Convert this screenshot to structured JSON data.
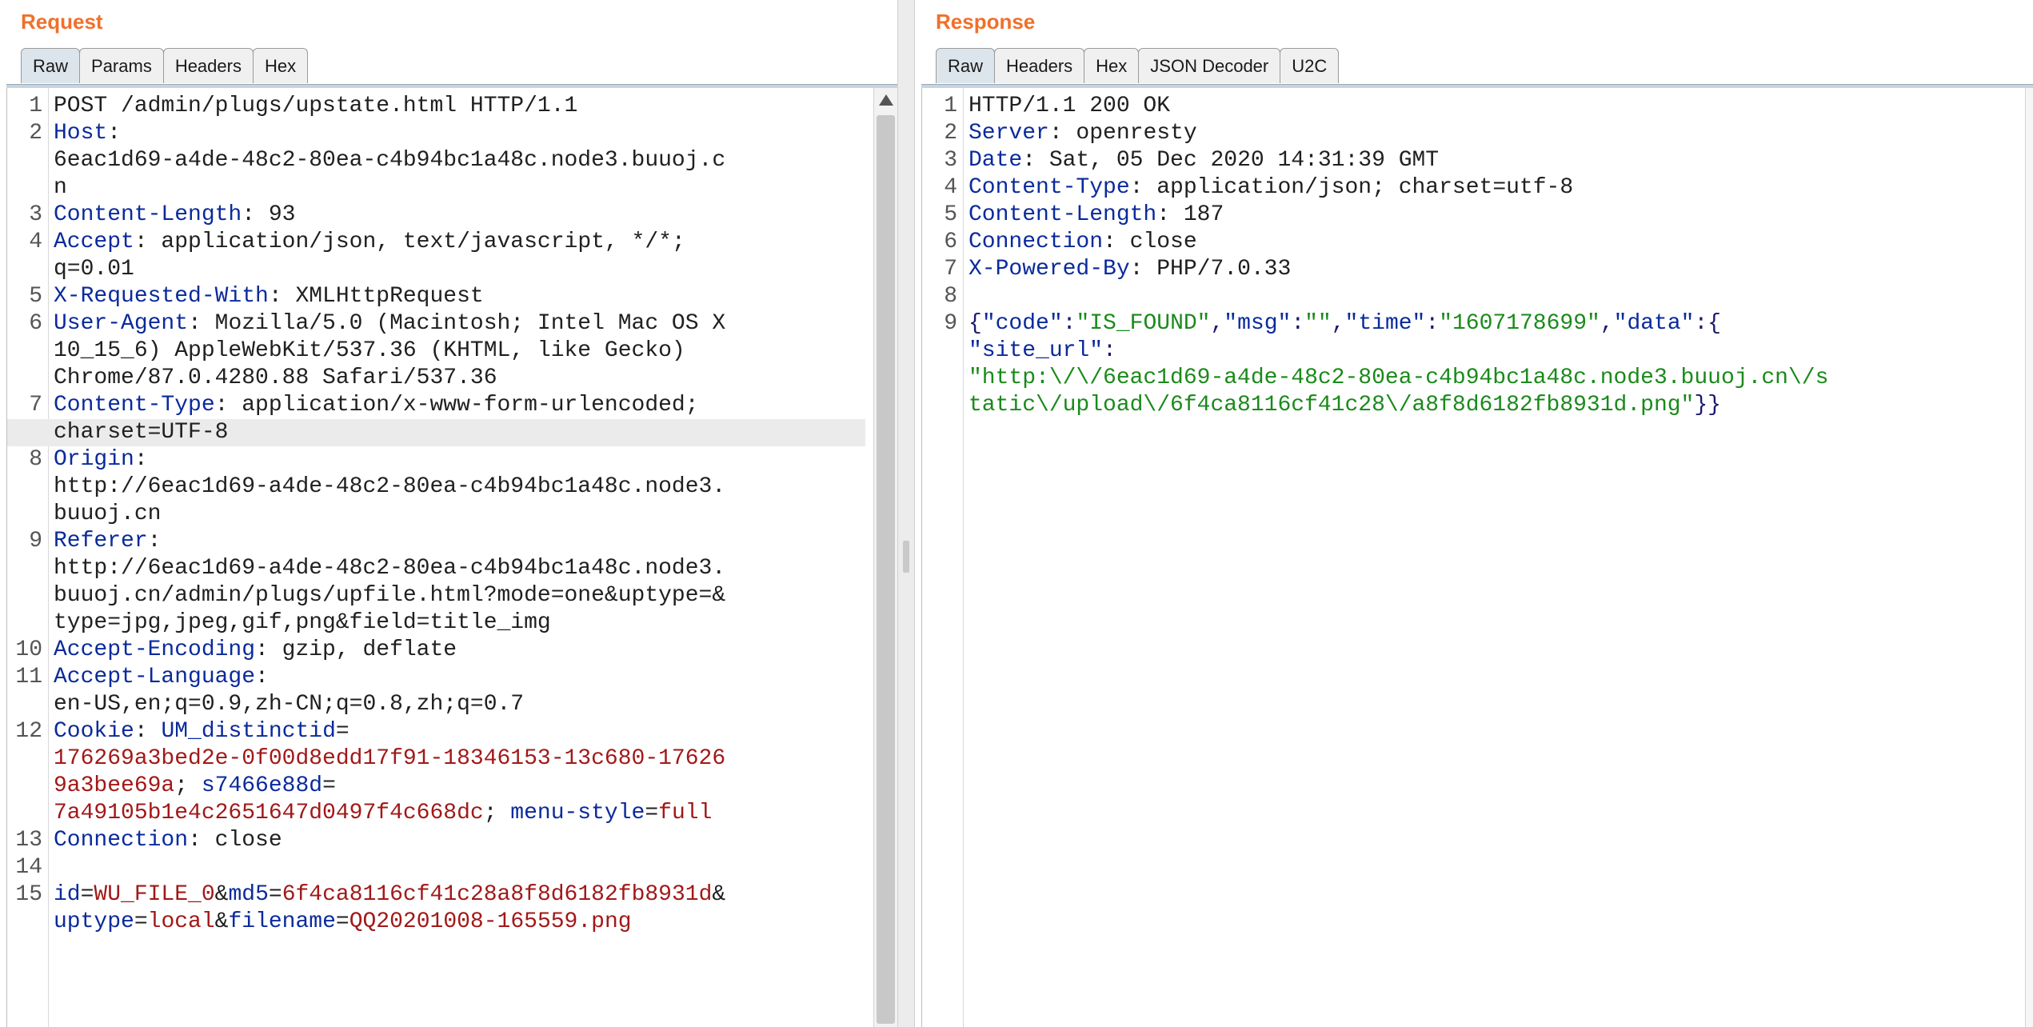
{
  "request": {
    "title": "Request",
    "tabs": [
      "Raw",
      "Params",
      "Headers",
      "Hex"
    ],
    "lines": [
      {
        "n": "1",
        "segments": [
          {
            "t": "POST /admin/plugs/upstate.html HTTP/1.1",
            "c": "v"
          }
        ]
      },
      {
        "n": "2",
        "segments": [
          {
            "t": "Host",
            "c": "k"
          },
          {
            "t": ":",
            "c": "v"
          }
        ]
      },
      {
        "n": "",
        "segments": [
          {
            "t": "6eac1d69-a4de-48c2-80ea-c4b94bc1a48c.node3.buuoj.c",
            "c": "v"
          }
        ]
      },
      {
        "n": "",
        "segments": [
          {
            "t": "n",
            "c": "v"
          }
        ]
      },
      {
        "n": "3",
        "segments": [
          {
            "t": "Content-Length",
            "c": "k"
          },
          {
            "t": ": 93",
            "c": "v"
          }
        ]
      },
      {
        "n": "4",
        "segments": [
          {
            "t": "Accept",
            "c": "k"
          },
          {
            "t": ": application/json, text/javascript, */*;",
            "c": "v"
          }
        ]
      },
      {
        "n": "",
        "segments": [
          {
            "t": "q=0.01",
            "c": "v"
          }
        ]
      },
      {
        "n": "5",
        "segments": [
          {
            "t": "X-Requested-With",
            "c": "k"
          },
          {
            "t": ": XMLHttpRequest",
            "c": "v"
          }
        ]
      },
      {
        "n": "6",
        "segments": [
          {
            "t": "User-Agent",
            "c": "k"
          },
          {
            "t": ": Mozilla/5.0 (Macintosh; Intel Mac OS X",
            "c": "v"
          }
        ]
      },
      {
        "n": "",
        "segments": [
          {
            "t": "10_15_6) AppleWebKit/537.36 (KHTML, like Gecko)",
            "c": "v"
          }
        ]
      },
      {
        "n": "",
        "segments": [
          {
            "t": "Chrome/87.0.4280.88 Safari/537.36",
            "c": "v"
          }
        ]
      },
      {
        "n": "7",
        "segments": [
          {
            "t": "Content-Type",
            "c": "k"
          },
          {
            "t": ": application/x-www-form-urlencoded;",
            "c": "v"
          }
        ]
      },
      {
        "n": "",
        "hl": true,
        "segments": [
          {
            "t": "charset=UTF-8",
            "c": "v"
          }
        ]
      },
      {
        "n": "8",
        "segments": [
          {
            "t": "Origin",
            "c": "k"
          },
          {
            "t": ":",
            "c": "v"
          }
        ]
      },
      {
        "n": "",
        "segments": [
          {
            "t": "http://6eac1d69-a4de-48c2-80ea-c4b94bc1a48c.node3.",
            "c": "v"
          }
        ]
      },
      {
        "n": "",
        "segments": [
          {
            "t": "buuoj.cn",
            "c": "v"
          }
        ]
      },
      {
        "n": "9",
        "segments": [
          {
            "t": "Referer",
            "c": "k"
          },
          {
            "t": ":",
            "c": "v"
          }
        ]
      },
      {
        "n": "",
        "segments": [
          {
            "t": "http://6eac1d69-a4de-48c2-80ea-c4b94bc1a48c.node3.",
            "c": "v"
          }
        ]
      },
      {
        "n": "",
        "segments": [
          {
            "t": "buuoj.cn/admin/plugs/upfile.html?mode=one&uptype=&",
            "c": "v"
          }
        ]
      },
      {
        "n": "",
        "segments": [
          {
            "t": "type=jpg,jpeg,gif,png&field=title_img",
            "c": "v"
          }
        ]
      },
      {
        "n": "10",
        "segments": [
          {
            "t": "Accept-Encoding",
            "c": "k"
          },
          {
            "t": ": gzip, deflate",
            "c": "v"
          }
        ]
      },
      {
        "n": "11",
        "segments": [
          {
            "t": "Accept-Language",
            "c": "k"
          },
          {
            "t": ":",
            "c": "v"
          }
        ]
      },
      {
        "n": "",
        "segments": [
          {
            "t": "en-US,en;q=0.9,zh-CN;q=0.8,zh;q=0.7",
            "c": "v"
          }
        ]
      },
      {
        "n": "12",
        "segments": [
          {
            "t": "Cookie",
            "c": "k"
          },
          {
            "t": ": ",
            "c": "v"
          },
          {
            "t": "UM_distinctid",
            "c": "pk"
          },
          {
            "t": "=",
            "c": "v"
          }
        ]
      },
      {
        "n": "",
        "segments": [
          {
            "t": "176269a3bed2e-0f00d8edd17f91-18346153-13c680-17626",
            "c": "pv"
          }
        ]
      },
      {
        "n": "",
        "segments": [
          {
            "t": "9a3bee69a",
            "c": "pv"
          },
          {
            "t": "; ",
            "c": "v"
          },
          {
            "t": "s7466e88d",
            "c": "pk"
          },
          {
            "t": "=",
            "c": "v"
          }
        ]
      },
      {
        "n": "",
        "segments": [
          {
            "t": "7a49105b1e4c2651647d0497f4c668dc",
            "c": "pv"
          },
          {
            "t": "; ",
            "c": "v"
          },
          {
            "t": "menu-style",
            "c": "pk"
          },
          {
            "t": "=",
            "c": "v"
          },
          {
            "t": "full",
            "c": "pv"
          }
        ]
      },
      {
        "n": "13",
        "segments": [
          {
            "t": "Connection",
            "c": "k"
          },
          {
            "t": ": close",
            "c": "v"
          }
        ]
      },
      {
        "n": "14",
        "segments": [
          {
            "t": "",
            "c": "v"
          }
        ]
      },
      {
        "n": "15",
        "segments": [
          {
            "t": "id",
            "c": "pk"
          },
          {
            "t": "=",
            "c": "v"
          },
          {
            "t": "WU_FILE_0",
            "c": "pv"
          },
          {
            "t": "&",
            "c": "v"
          },
          {
            "t": "md5",
            "c": "pk"
          },
          {
            "t": "=",
            "c": "v"
          },
          {
            "t": "6f4ca8116cf41c28a8f8d6182fb8931d",
            "c": "pv"
          },
          {
            "t": "&",
            "c": "v"
          }
        ]
      },
      {
        "n": "",
        "segments": [
          {
            "t": "uptype",
            "c": "pk"
          },
          {
            "t": "=",
            "c": "v"
          },
          {
            "t": "local",
            "c": "pv"
          },
          {
            "t": "&",
            "c": "v"
          },
          {
            "t": "filename",
            "c": "pk"
          },
          {
            "t": "=",
            "c": "v"
          },
          {
            "t": "QQ20201008-165559.png",
            "c": "pv"
          }
        ]
      }
    ]
  },
  "response": {
    "title": "Response",
    "tabs": [
      "Raw",
      "Headers",
      "Hex",
      "JSON Decoder",
      "U2C"
    ],
    "lines": [
      {
        "n": "1",
        "segments": [
          {
            "t": "HTTP/1.1 200 OK",
            "c": "v"
          }
        ]
      },
      {
        "n": "2",
        "segments": [
          {
            "t": "Server",
            "c": "k"
          },
          {
            "t": ": openresty",
            "c": "v"
          }
        ]
      },
      {
        "n": "3",
        "segments": [
          {
            "t": "Date",
            "c": "k"
          },
          {
            "t": ": Sat, 05 Dec 2020 14:31:39 GMT",
            "c": "v"
          }
        ]
      },
      {
        "n": "4",
        "segments": [
          {
            "t": "Content-Type",
            "c": "k"
          },
          {
            "t": ": application/json; charset=utf-8",
            "c": "v"
          }
        ]
      },
      {
        "n": "5",
        "segments": [
          {
            "t": "Content-Length",
            "c": "k"
          },
          {
            "t": ": 187",
            "c": "v"
          }
        ]
      },
      {
        "n": "6",
        "segments": [
          {
            "t": "Connection",
            "c": "k"
          },
          {
            "t": ": close",
            "c": "v"
          }
        ]
      },
      {
        "n": "7",
        "segments": [
          {
            "t": "X-Powered-By",
            "c": "k"
          },
          {
            "t": ": PHP/7.0.33",
            "c": "v"
          }
        ]
      },
      {
        "n": "8",
        "segments": [
          {
            "t": "",
            "c": "v"
          }
        ]
      },
      {
        "n": "9",
        "segments": [
          {
            "t": "{",
            "c": "js"
          },
          {
            "t": "\"code\"",
            "c": "jk"
          },
          {
            "t": ":",
            "c": "js"
          },
          {
            "t": "\"IS_FOUND\"",
            "c": "jv"
          },
          {
            "t": ",",
            "c": "js"
          },
          {
            "t": "\"msg\"",
            "c": "jk"
          },
          {
            "t": ":",
            "c": "js"
          },
          {
            "t": "\"\"",
            "c": "jv"
          },
          {
            "t": ",",
            "c": "js"
          },
          {
            "t": "\"time\"",
            "c": "jk"
          },
          {
            "t": ":",
            "c": "js"
          },
          {
            "t": "\"1607178699\"",
            "c": "jv"
          },
          {
            "t": ",",
            "c": "js"
          },
          {
            "t": "\"data\"",
            "c": "jk"
          },
          {
            "t": ":{",
            "c": "js"
          }
        ]
      },
      {
        "n": "",
        "segments": [
          {
            "t": "\"site_url\"",
            "c": "jk"
          },
          {
            "t": ":",
            "c": "js"
          }
        ]
      },
      {
        "n": "",
        "segments": [
          {
            "t": "\"http:\\/\\/6eac1d69-a4de-48c2-80ea-c4b94bc1a48c.node3.buuoj.cn\\/s",
            "c": "jv"
          }
        ]
      },
      {
        "n": "",
        "segments": [
          {
            "t": "tatic\\/upload\\/6f4ca8116cf41c28\\/a8f8d6182fb8931d.png\"",
            "c": "jv"
          },
          {
            "t": "}}",
            "c": "js"
          }
        ]
      }
    ]
  }
}
